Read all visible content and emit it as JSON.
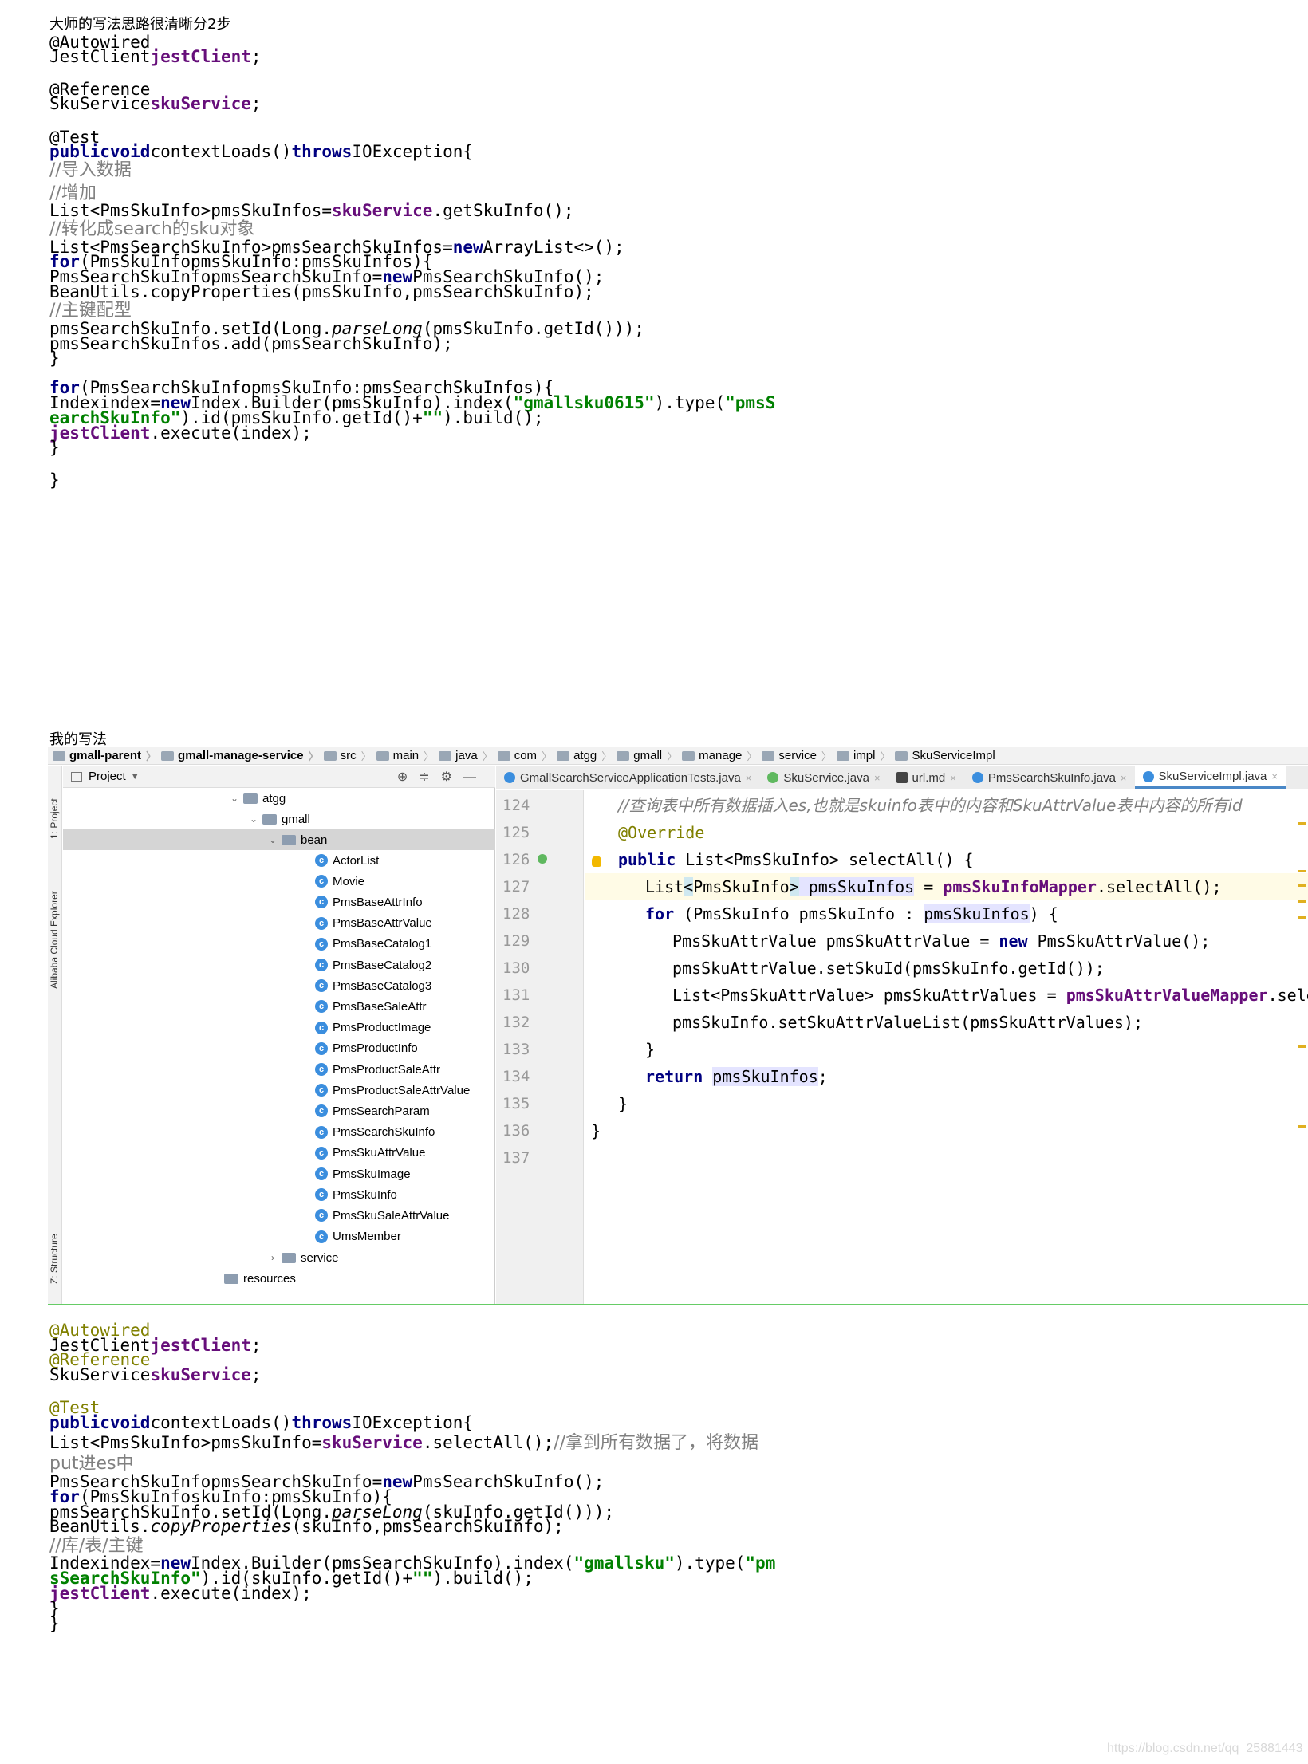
{
  "master": {
    "heading": "大师的写法思路很清晰分2步",
    "lines": [
      {
        "parts": [
          {
            "t": "@Autowired",
            "c": "plain"
          }
        ]
      },
      {
        "parts": [
          {
            "t": "JestClient",
            "c": "plain"
          },
          {
            "t": "jestClient",
            "c": "fld"
          },
          {
            "t": ";",
            "c": "plain"
          }
        ]
      },
      {
        "parts": [
          {
            "t": "@Reference",
            "c": "plain"
          }
        ]
      },
      {
        "parts": [
          {
            "t": "SkuService",
            "c": "plain"
          },
          {
            "t": "skuService",
            "c": "fld"
          },
          {
            "t": ";",
            "c": "plain"
          }
        ]
      },
      {
        "parts": [
          {
            "t": "@Test",
            "c": "plain"
          }
        ]
      },
      {
        "parts": [
          {
            "t": "publicvoid",
            "c": "kw"
          },
          {
            "t": "contextLoads()",
            "c": "plain"
          },
          {
            "t": "throws",
            "c": "kw"
          },
          {
            "t": "IOException{",
            "c": "plain"
          }
        ]
      },
      {
        "parts": [
          {
            "t": "//导入数据",
            "c": "cmt"
          }
        ]
      },
      {
        "parts": [
          {
            "t": "//增加",
            "c": "cmt"
          }
        ]
      },
      {
        "parts": [
          {
            "t": "List<PmsSkuInfo>pmsSkuInfos=",
            "c": "plain"
          },
          {
            "t": "skuService",
            "c": "fld"
          },
          {
            "t": ".getSkuInfo();",
            "c": "plain"
          }
        ]
      },
      {
        "parts": [
          {
            "t": "//转化成search的sku对象",
            "c": "cmt"
          }
        ]
      },
      {
        "parts": [
          {
            "t": "List<PmsSearchSkuInfo>pmsSearchSkuInfos=",
            "c": "plain"
          },
          {
            "t": "new",
            "c": "kw"
          },
          {
            "t": "ArrayList<>();",
            "c": "plain"
          }
        ]
      },
      {
        "parts": [
          {
            "t": "for",
            "c": "kw"
          },
          {
            "t": "(PmsSkuInfopmsSkuInfo:pmsSkuInfos){",
            "c": "plain"
          }
        ]
      },
      {
        "parts": [
          {
            "t": "PmsSearchSkuInfopmsSearchSkuInfo=",
            "c": "plain"
          },
          {
            "t": "new",
            "c": "kw"
          },
          {
            "t": "PmsSearchSkuInfo();",
            "c": "plain"
          }
        ]
      },
      {
        "parts": [
          {
            "t": "BeanUtils.copyProperties(pmsSkuInfo,pmsSearchSkuInfo);",
            "c": "plain"
          }
        ]
      },
      {
        "parts": [
          {
            "t": "//主键配型",
            "c": "cmt"
          }
        ]
      },
      {
        "parts": [
          {
            "t": "pmsSearchSkuInfo.setId(Long.",
            "c": "plain"
          },
          {
            "t": "parseLong",
            "c": "it"
          },
          {
            "t": "(pmsSkuInfo.getId()));",
            "c": "plain"
          }
        ]
      },
      {
        "parts": [
          {
            "t": "pmsSearchSkuInfos.add(pmsSearchSkuInfo);",
            "c": "plain"
          }
        ]
      },
      {
        "parts": [
          {
            "t": "}",
            "c": "plain"
          }
        ]
      },
      {
        "parts": [
          {
            "t": "for",
            "c": "kw"
          },
          {
            "t": "(PmsSearchSkuInfopmsSkuInfo:pmsSearchSkuInfos){",
            "c": "plain"
          }
        ]
      },
      {
        "parts": [
          {
            "t": "Indexindex=",
            "c": "plain"
          },
          {
            "t": "new",
            "c": "kw"
          },
          {
            "t": "Index.Builder(pmsSkuInfo).index(",
            "c": "plain"
          },
          {
            "t": "\"gmallsku0615\"",
            "c": "str"
          },
          {
            "t": ").type(",
            "c": "plain"
          },
          {
            "t": "\"pmsS",
            "c": "str"
          }
        ]
      },
      {
        "parts": [
          {
            "t": "earchSkuInfo\"",
            "c": "str"
          },
          {
            "t": ").id(pmsSkuInfo.getId()+",
            "c": "plain"
          },
          {
            "t": "\"\"",
            "c": "str"
          },
          {
            "t": ").build();",
            "c": "plain"
          }
        ]
      },
      {
        "parts": [
          {
            "t": "jestClient",
            "c": "fld"
          },
          {
            "t": ".execute(index);",
            "c": "plain"
          }
        ]
      },
      {
        "parts": [
          {
            "t": "}",
            "c": "plain"
          }
        ]
      },
      {
        "parts": [
          {
            "t": "}",
            "c": "plain"
          }
        ]
      }
    ]
  },
  "mine": {
    "heading": "我的写法",
    "lines": [
      {
        "parts": [
          {
            "t": "@Autowired",
            "c": "ann"
          }
        ]
      },
      {
        "parts": [
          {
            "t": "JestClient",
            "c": "plain"
          },
          {
            "t": "jestClient",
            "c": "fld"
          },
          {
            "t": ";",
            "c": "plain"
          }
        ]
      },
      {
        "parts": [
          {
            "t": "@Reference",
            "c": "ann"
          }
        ]
      },
      {
        "parts": [
          {
            "t": "SkuService",
            "c": "plain"
          },
          {
            "t": "skuService",
            "c": "fld"
          },
          {
            "t": ";",
            "c": "plain"
          }
        ]
      },
      {
        "parts": [
          {
            "t": "@Test",
            "c": "ann"
          }
        ]
      },
      {
        "parts": [
          {
            "t": "publicvoid",
            "c": "kw"
          },
          {
            "t": "contextLoads()",
            "c": "plain"
          },
          {
            "t": "throws",
            "c": "kw"
          },
          {
            "t": "IOException{",
            "c": "plain"
          }
        ]
      },
      {
        "parts": [
          {
            "t": "List<PmsSkuInfo>pmsSkuInfo=",
            "c": "plain"
          },
          {
            "t": "skuService",
            "c": "fld"
          },
          {
            "t": ".selectAll();",
            "c": "plain"
          },
          {
            "t": "//拿到所有数据了，将数据",
            "c": "cmt"
          }
        ]
      },
      {
        "parts": [
          {
            "t": "put进es中",
            "c": "cmt"
          }
        ]
      },
      {
        "parts": [
          {
            "t": "PmsSearchSkuInfopmsSearchSkuInfo=",
            "c": "plain"
          },
          {
            "t": "new",
            "c": "kw"
          },
          {
            "t": "PmsSearchSkuInfo();",
            "c": "plain"
          }
        ]
      },
      {
        "parts": [
          {
            "t": "for",
            "c": "kw"
          },
          {
            "t": "(PmsSkuInfoskuInfo:pmsSkuInfo){",
            "c": "plain"
          }
        ]
      },
      {
        "parts": [
          {
            "t": "pmsSearchSkuInfo.setId(Long.",
            "c": "plain"
          },
          {
            "t": "parseLong",
            "c": "it"
          },
          {
            "t": "(skuInfo.getId()));",
            "c": "plain"
          }
        ]
      },
      {
        "parts": [
          {
            "t": "BeanUtils.",
            "c": "plain"
          },
          {
            "t": "copyProperties",
            "c": "it"
          },
          {
            "t": "(skuInfo,pmsSearchSkuInfo);",
            "c": "plain"
          }
        ]
      },
      {
        "parts": [
          {
            "t": "//库/表/主键",
            "c": "cmt"
          }
        ]
      },
      {
        "parts": [
          {
            "t": "Indexindex=",
            "c": "plain"
          },
          {
            "t": "new",
            "c": "kw"
          },
          {
            "t": "Index.Builder(pmsSearchSkuInfo).index(",
            "c": "plain"
          },
          {
            "t": "\"gmallsku\"",
            "c": "str"
          },
          {
            "t": ").type(",
            "c": "plain"
          },
          {
            "t": "\"pm",
            "c": "str"
          }
        ]
      },
      {
        "parts": [
          {
            "t": "sSearchSkuInfo\"",
            "c": "str"
          },
          {
            "t": ").id(skuInfo.getId()+",
            "c": "plain"
          },
          {
            "t": "\"\"",
            "c": "str"
          },
          {
            "t": ").build();",
            "c": "plain"
          }
        ]
      },
      {
        "parts": [
          {
            "t": "jestClient",
            "c": "fld"
          },
          {
            "t": ".execute(index);",
            "c": "plain"
          }
        ]
      },
      {
        "parts": [
          {
            "t": "}",
            "c": "plain"
          }
        ]
      },
      {
        "parts": [
          {
            "t": "}",
            "c": "plain"
          }
        ]
      }
    ]
  },
  "ide": {
    "breadcrumbs": [
      "gmall-parent",
      "gmall-manage-service",
      "src",
      "main",
      "java",
      "com",
      "atgg",
      "gmall",
      "manage",
      "service",
      "impl",
      "SkuServiceImpl"
    ],
    "side_tabs": [
      "1: Project",
      "Alibaba Cloud Explorer",
      "Z: Structure"
    ],
    "project_label": "Project",
    "tree": {
      "atgg": "atgg",
      "gmall": "gmall",
      "bean": "bean",
      "classes": [
        "ActorList",
        "Movie",
        "PmsBaseAttrInfo",
        "PmsBaseAttrValue",
        "PmsBaseCatalog1",
        "PmsBaseCatalog2",
        "PmsBaseCatalog3",
        "PmsBaseSaleAttr",
        "PmsProductImage",
        "PmsProductInfo",
        "PmsProductSaleAttr",
        "PmsProductSaleAttrValue",
        "PmsSearchParam",
        "PmsSearchSkuInfo",
        "PmsSkuAttrValue",
        "PmsSkuImage",
        "PmsSkuInfo",
        "PmsSkuSaleAttrValue",
        "UmsMember"
      ],
      "service": "service",
      "resources": "resources"
    },
    "tabs": [
      {
        "label": "GmallSearchServiceApplicationTests.java",
        "icon": "class-icon"
      },
      {
        "label": "SkuService.java",
        "icon": "interface-icon"
      },
      {
        "label": "url.md",
        "icon": "markdown-icon"
      },
      {
        "label": "PmsSearchSkuInfo.java",
        "icon": "class-icon"
      },
      {
        "label": "SkuServiceImpl.java",
        "icon": "class-icon",
        "active": true
      }
    ],
    "line_numbers": [
      "124",
      "125",
      "126",
      "127",
      "128",
      "129",
      "130",
      "131",
      "132",
      "133",
      "134",
      "135",
      "136",
      "137"
    ],
    "code": [
      {
        "indent": 1,
        "parts": [
          {
            "t": "//查询表中所有数据插入es,也就是skuinfo表中的内容和SkuAttrValue表中内容的所有id",
            "c": "icmt"
          }
        ]
      },
      {
        "indent": 1,
        "parts": [
          {
            "t": "@Override",
            "c": "iann"
          }
        ]
      },
      {
        "indent": 1,
        "parts": [
          {
            "t": "public",
            "c": "ikw"
          },
          {
            "t": " List<PmsSkuInfo> selectAll() {",
            "c": "plain"
          }
        ]
      },
      {
        "indent": 2,
        "cur": true,
        "parts": [
          {
            "t": "List",
            "c": "plain"
          },
          {
            "t": "<",
            "c": "bracket"
          },
          {
            "t": "PmsSkuInfo",
            "c": "plain"
          },
          {
            "t": ">",
            "c": "bracket"
          },
          {
            "t": " pmsSkuInfos",
            "c": "hl"
          },
          {
            "t": " = ",
            "c": "plain"
          },
          {
            "t": "pmsSkuInfoMapper",
            "c": "ifld"
          },
          {
            "t": ".selectAll();",
            "c": "plain"
          }
        ]
      },
      {
        "indent": 2,
        "parts": [
          {
            "t": "for",
            "c": "ikw"
          },
          {
            "t": " (PmsSkuInfo pmsSkuInfo : ",
            "c": "plain"
          },
          {
            "t": "pmsSkuInfos",
            "c": "hl"
          },
          {
            "t": ") {",
            "c": "plain"
          }
        ]
      },
      {
        "indent": 3,
        "parts": [
          {
            "t": "PmsSkuAttrValue pmsSkuAttrValue = ",
            "c": "plain"
          },
          {
            "t": "new",
            "c": "ikw"
          },
          {
            "t": " PmsSkuAttrValue();",
            "c": "plain"
          }
        ]
      },
      {
        "indent": 3,
        "parts": [
          {
            "t": "pmsSkuAttrValue.setSkuId(pmsSkuInfo.getId());",
            "c": "plain"
          }
        ]
      },
      {
        "indent": 3,
        "parts": [
          {
            "t": "List<PmsSkuAttrValue> pmsSkuAttrValues = ",
            "c": "plain"
          },
          {
            "t": "pmsSkuAttrValueMapper",
            "c": "ifld"
          },
          {
            "t": ".selec",
            "c": "plain"
          }
        ]
      },
      {
        "indent": 3,
        "parts": [
          {
            "t": "pmsSkuInfo.setSkuAttrValueList(pmsSkuAttrValues);",
            "c": "plain"
          }
        ]
      },
      {
        "indent": 2,
        "parts": [
          {
            "t": "}",
            "c": "plain"
          }
        ]
      },
      {
        "indent": 2,
        "parts": [
          {
            "t": "return",
            "c": "ikw"
          },
          {
            "t": " ",
            "c": "plain"
          },
          {
            "t": "pmsSkuInfos",
            "c": "hl"
          },
          {
            "t": ";",
            "c": "plain"
          }
        ]
      },
      {
        "indent": 1,
        "parts": [
          {
            "t": "}",
            "c": "plain"
          }
        ]
      },
      {
        "indent": 0,
        "parts": [
          {
            "t": "}",
            "c": "plain"
          }
        ]
      },
      {
        "indent": 0,
        "parts": [
          {
            "t": "",
            "c": "plain"
          }
        ]
      }
    ]
  },
  "watermark": "https://blog.csdn.net/qq_25881443"
}
